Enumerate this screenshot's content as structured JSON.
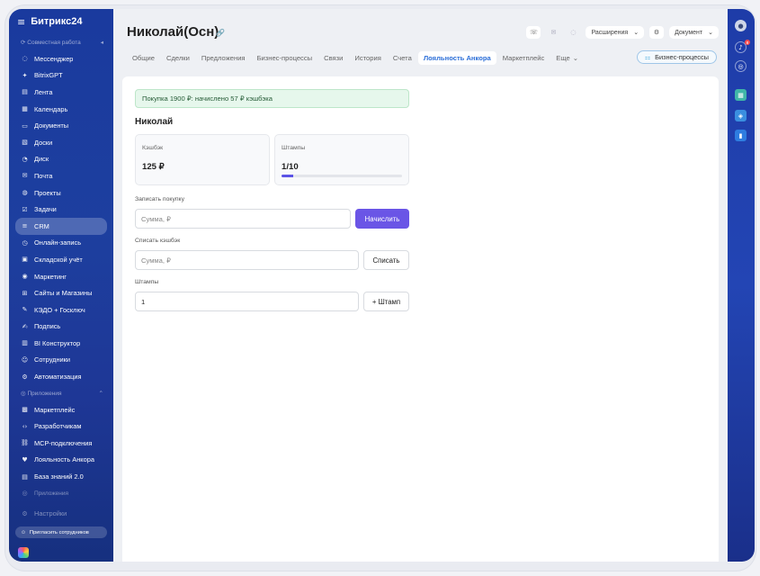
{
  "sidebar": {
    "logo": "Битрикс24",
    "section_work": "Совместная работа",
    "items": [
      {
        "label": "Мессенджер",
        "icon": "chat-icon"
      },
      {
        "label": "BitrixGPT",
        "icon": "gpt-icon"
      },
      {
        "label": "Лента",
        "icon": "feed-icon"
      },
      {
        "label": "Календарь",
        "icon": "calendar-icon"
      },
      {
        "label": "Документы",
        "icon": "documents-icon"
      },
      {
        "label": "Доски",
        "icon": "boards-icon"
      },
      {
        "label": "Диск",
        "icon": "disk-icon"
      },
      {
        "label": "Почта",
        "icon": "mail-icon"
      },
      {
        "label": "Проекты",
        "icon": "projects-icon"
      },
      {
        "label": "Задачи",
        "icon": "tasks-icon"
      },
      {
        "label": "CRM",
        "icon": "crm-icon"
      },
      {
        "label": "Онлайн-запись",
        "icon": "booking-icon"
      },
      {
        "label": "Складской учёт",
        "icon": "warehouse-icon"
      },
      {
        "label": "Маркетинг",
        "icon": "marketing-icon"
      },
      {
        "label": "Сайты и Магазины",
        "icon": "shop-icon"
      },
      {
        "label": "КЭДО + Госключ",
        "icon": "kedo-icon"
      },
      {
        "label": "Подпись",
        "icon": "signature-icon"
      },
      {
        "label": "BI Конструктор",
        "icon": "bi-icon"
      },
      {
        "label": "Сотрудники",
        "icon": "employees-icon"
      },
      {
        "label": "Автоматизация",
        "icon": "automation-icon"
      }
    ],
    "section_apps": "Приложения",
    "app_items": [
      {
        "label": "Маркетплейс",
        "icon": "marketplace-icon"
      },
      {
        "label": "Разработчикам",
        "icon": "developer-icon"
      },
      {
        "label": "MCP-подключения",
        "icon": "mcp-icon"
      },
      {
        "label": "Лояльность Анкора",
        "icon": "loyalty-icon"
      },
      {
        "label": "База знаний 2.0",
        "icon": "knowledge-icon"
      }
    ],
    "section_apps2": "Приложения",
    "settings": "Настройки",
    "invite": "Пригласить сотрудников"
  },
  "header": {
    "title": "Николай(Осн)",
    "extensions": "Расширения",
    "document": "Документ"
  },
  "tabs": [
    {
      "label": "Общие"
    },
    {
      "label": "Сделки"
    },
    {
      "label": "Предложения"
    },
    {
      "label": "Бизнес-процессы"
    },
    {
      "label": "Связи"
    },
    {
      "label": "История"
    },
    {
      "label": "Счета"
    },
    {
      "label": "Лояльность Анкора"
    },
    {
      "label": "Маркетплейс"
    },
    {
      "label": "Еще"
    }
  ],
  "bp_button": "Бизнес-процессы",
  "loyalty": {
    "alert": "Покупка 1900 ₽: начислено 57 ₽ кэшбэка",
    "customer_name": "Николай",
    "cashback_label": "Кэшбэк",
    "cashback_value": "125 ₽",
    "stamps_label": "Штампы",
    "stamps_value": "1/10",
    "stamps_progress": 0.1,
    "record_purchase_label": "Записать покупку",
    "amount_placeholder": "Сумма, ₽",
    "accrue_button": "Начислить",
    "writeoff_label": "Списать кэшбэк",
    "writeoff_placeholder": "Сумма, ₽",
    "writeoff_button": "Списать",
    "stamps_field_label": "Штампы",
    "stamps_input_value": "1",
    "add_stamp_button": "+ Штамп"
  },
  "rightbar": {
    "notification_count": "8"
  },
  "colors": {
    "accent": "#6a55e6",
    "sidebar": "#1d3f9f",
    "active_tab": "#2a6ed8",
    "alert_bg": "#e6f7ec"
  }
}
